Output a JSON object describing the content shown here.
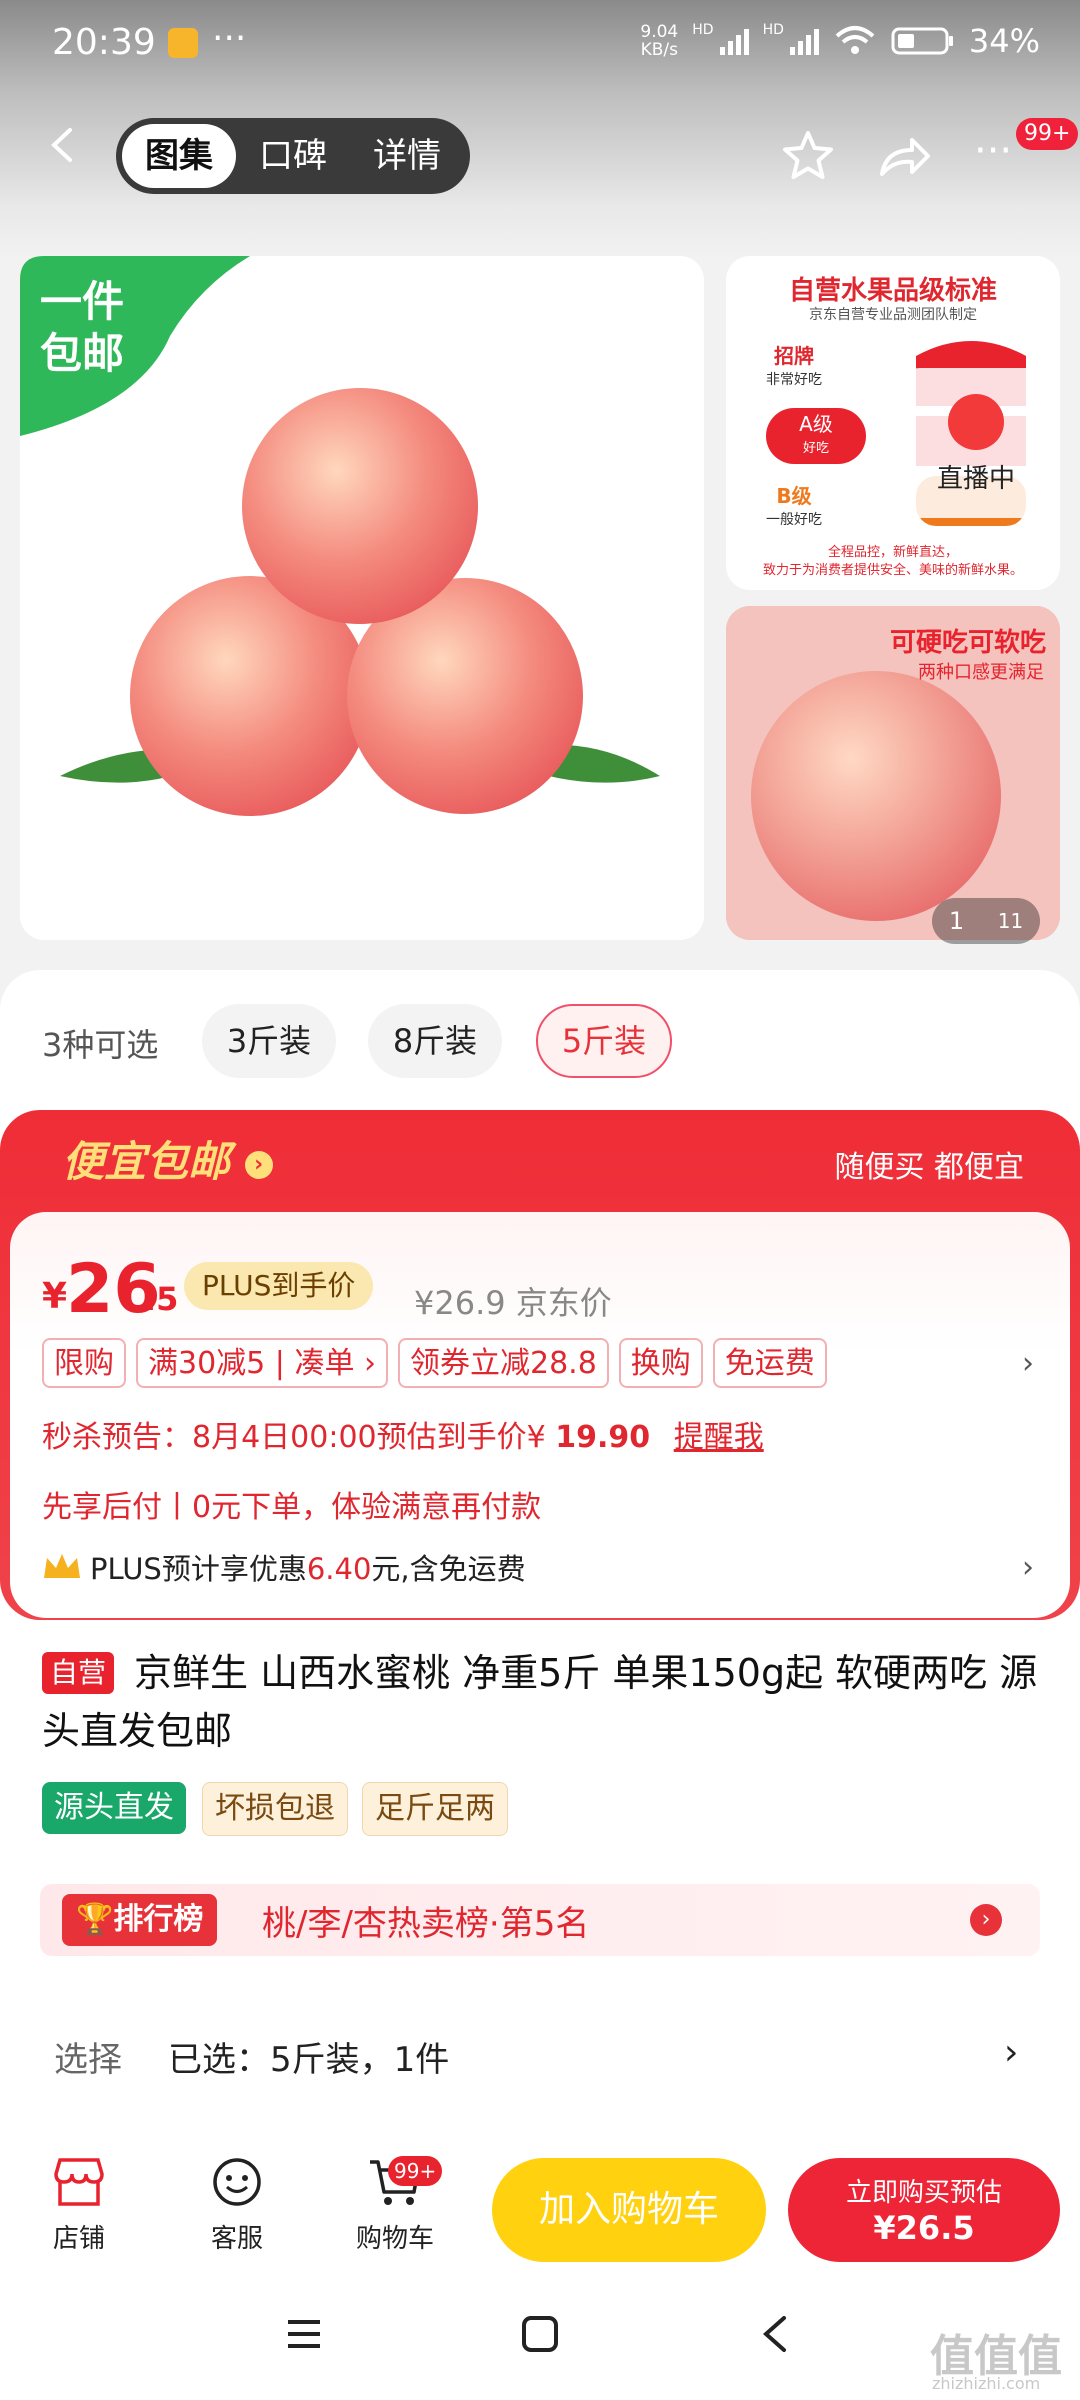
{
  "status": {
    "time": "20:39",
    "net_speed_top": "9.04",
    "net_speed_unit": "KB/s",
    "hd1": "HD",
    "hd2": "HD",
    "battery": "34%"
  },
  "header": {
    "tabs": [
      "图集",
      "口碑",
      "详情"
    ],
    "active_tab": 0,
    "more_badge": "99+"
  },
  "gallery": {
    "ribbon": [
      "一件",
      "包邮"
    ],
    "thumb1": {
      "title": "自营水果品级标准",
      "subtitle": "京东自营专业品测团队制定",
      "grade1": "招牌",
      "grade1_sub": "非常好吃",
      "grade2": "A级",
      "grade2_sub": "好吃",
      "grade3": "B级",
      "grade3_sub": "一般好吃",
      "footer1": "全程品控，新鲜直达，",
      "footer2": "致力于为消费者提供安全、美味的新鲜水果。"
    },
    "live_label": "直播中",
    "thumb2": {
      "title": "可硬吃可软吃",
      "subtitle": "两种口感更满足"
    },
    "counter_current": "1",
    "counter_total": "11"
  },
  "options": {
    "label": "3种可选",
    "items": [
      "3斤装",
      "8斤装",
      "5斤装"
    ],
    "selected": 2
  },
  "promo": {
    "title": "便宜包邮",
    "right": "随便买 都便宜",
    "currency": "¥",
    "price_int": "26",
    "price_dec": ".5",
    "plus_tag": "PLUS到手价",
    "jd_price": "¥26.9 京东价",
    "tags": [
      "限购",
      "满30减5 | 凑单 ›",
      "领券立减28.8",
      "换购",
      "免运费"
    ],
    "seckill_prefix": "秒杀预告：8月4日00:00预估到手价¥ ",
    "seckill_price": "19.90",
    "remind": "提醒我",
    "paylater": "先享后付丨0元下单，体验满意再付款",
    "plus_line_a": "PLUS预计享优惠",
    "plus_line_amt": "6.40",
    "plus_line_b": "元,含免运费"
  },
  "product": {
    "self_tag": "自营",
    "title": "京鲜生 山西水蜜桃 净重5斤 单果150g起 软硬两吃 源头直发包邮",
    "tags": [
      "源头直发",
      "坏损包退",
      "足斤足两"
    ]
  },
  "rank": {
    "tag": "排行榜",
    "text": "桃/李/杏热卖榜·第5名"
  },
  "selection": {
    "label": "选择",
    "value": "已选：5斤装，1件"
  },
  "bottom": {
    "shop": "店铺",
    "service": "客服",
    "cart": "购物车",
    "cart_badge": "99+",
    "add_cart": "加入购物车",
    "buy_line1": "立即购买预估",
    "buy_line2": "¥26.5"
  },
  "watermark": "值值值",
  "watermark_sub": "zhizhizhi.com",
  "colors": {
    "accent_red": "#e8232e",
    "yellow": "#ffd10f",
    "green": "#1aa86a"
  }
}
